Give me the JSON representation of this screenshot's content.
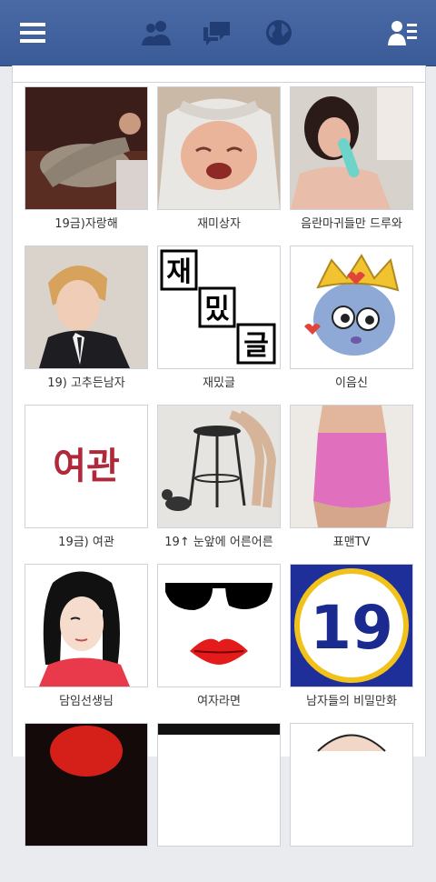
{
  "topbar": {
    "icons": [
      "menu-icon",
      "friends-icon",
      "messages-icon",
      "globe-icon",
      "contacts-list-icon"
    ],
    "bg_color": "#3b5b98"
  },
  "grid": {
    "items": [
      {
        "label": "19금)자랑해",
        "icon": "thumbnail-photo"
      },
      {
        "label": "재미상자",
        "icon": "thumbnail-baby"
      },
      {
        "label": "음란마귀들만 드루와",
        "icon": "thumbnail-photo"
      },
      {
        "label": "19) 고추든남자",
        "icon": "thumbnail-doll"
      },
      {
        "label": "재밌글",
        "icon": "thumbnail-text-logo"
      },
      {
        "label": "이음신",
        "icon": "thumbnail-cartoon"
      },
      {
        "label": "19금) 여관",
        "icon": "thumbnail-text-logo"
      },
      {
        "label": "19↑ 눈앞에 어른어른",
        "icon": "thumbnail-photo"
      },
      {
        "label": "표맨TV",
        "icon": "thumbnail-photo"
      },
      {
        "label": "담임선생님",
        "icon": "thumbnail-illustration"
      },
      {
        "label": "여자라면",
        "icon": "thumbnail-sunglasses-lips"
      },
      {
        "label": "남자들의 비밀만화",
        "icon": "thumbnail-19-badge"
      }
    ],
    "thumb_text": {
      "jae_syllables": [
        "재",
        "밌",
        "글"
      ],
      "yeogwan": "여관",
      "badge": "19"
    }
  }
}
